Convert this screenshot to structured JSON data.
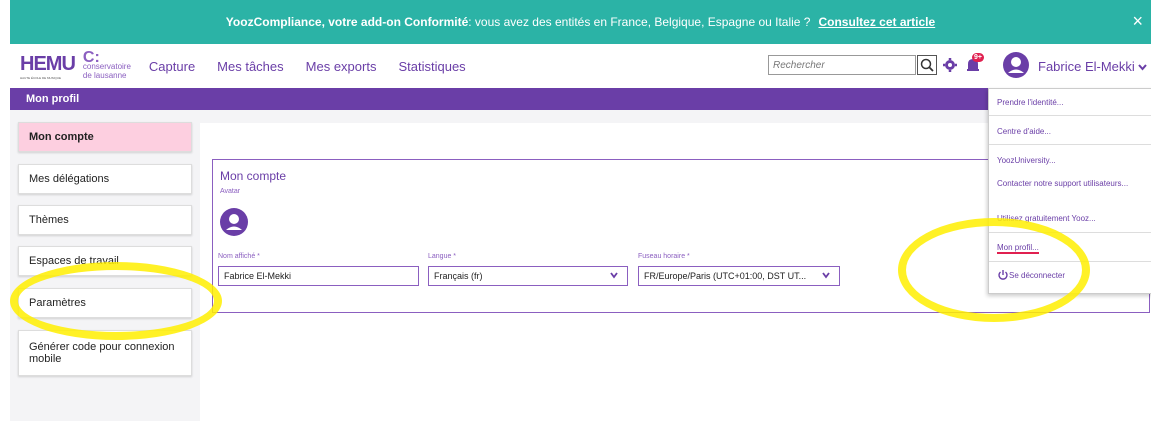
{
  "banner": {
    "bold_text": "YoozCompliance, votre add-on Conformité",
    "text": " : vous avez des entités en France, Belgique, Espagne ou Italie ?",
    "link": "Consultez cet article",
    "close": "×"
  },
  "logo": {
    "hemu": "HEMU",
    "hemu_sub": "HAUTE ÉCOLE DE MUSIQUE",
    "c": "C:",
    "line1": "conservatoire",
    "line2": "de lausanne"
  },
  "nav": {
    "items": [
      "Capture",
      "Mes tâches",
      "Mes exports",
      "Statistiques"
    ],
    "search_placeholder": "Rechercher",
    "badge": "9+",
    "user_name": "Fabrice El-Mekki"
  },
  "page_title": "Mon profil",
  "sidebar": {
    "items": [
      "Mon compte",
      "Mes délégations",
      "Thèmes",
      "Espaces de travail",
      "Paramètres",
      "Générer code pour connexion mobile"
    ]
  },
  "card": {
    "title": "Mon compte",
    "avatar_label": "Avatar",
    "name_label": "Nom affiché *",
    "name_value": "Fabrice El-Mekki",
    "lang_label": "Langue *",
    "lang_value": "Français (fr)",
    "tz_label": "Fuseau horaire *",
    "tz_value": "FR/Europe/Paris (UTC+01:00, DST UT..."
  },
  "dropdown": {
    "items": [
      "Prendre l'identité...",
      "Centre d'aide...",
      "YoozUniversity...",
      "Contacter notre support utilisateurs...",
      "Utilisez gratuitement Yooz...",
      "Mon profil...",
      "Se déconnecter"
    ]
  },
  "colors": {
    "banner": "#2bb3a6",
    "brand": "#6a3ea7",
    "active": "#fdcfe0",
    "highlight": "#ffee00"
  },
  "icons": [
    "close-icon",
    "search-icon",
    "gear-icon",
    "bell-icon",
    "user-avatar-icon",
    "chevron-down-icon",
    "power-icon"
  ]
}
